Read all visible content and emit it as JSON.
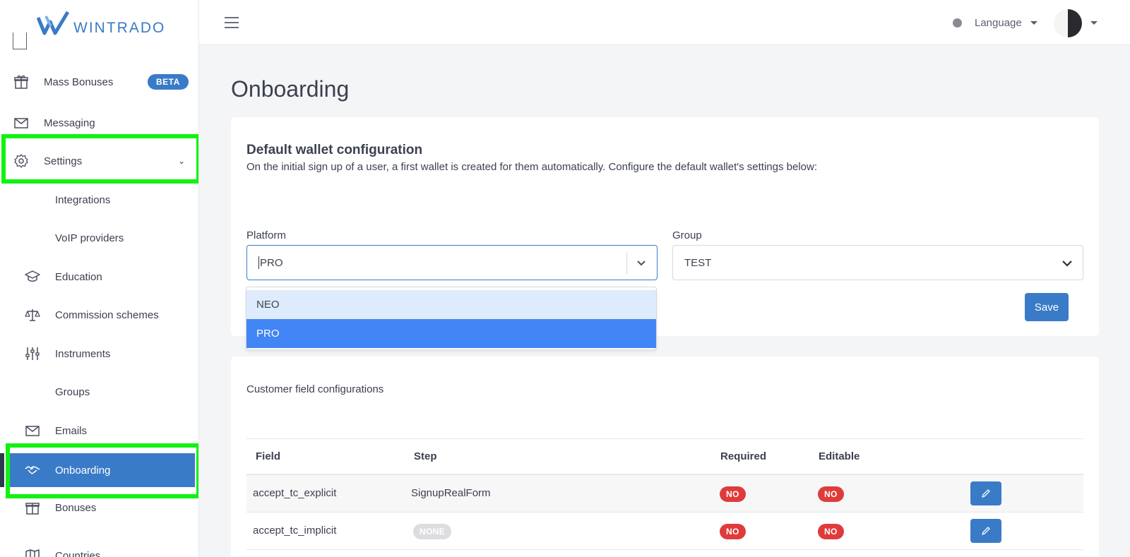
{
  "brand": {
    "name": "WINTRADO",
    "accent": "#3a7bc8"
  },
  "sidebar": {
    "items": [
      {
        "label": "Mass Bonuses",
        "icon": "gift-icon",
        "badge": "BETA"
      },
      {
        "label": "Messaging",
        "icon": "envelope-icon"
      },
      {
        "label": "Settings",
        "icon": "gear-icon",
        "expanded": true
      },
      {
        "label": "Integrations"
      },
      {
        "label": "VoIP providers"
      },
      {
        "label": "Education",
        "icon": "graduation-cap-icon"
      },
      {
        "label": "Commission schemes",
        "icon": "scales-icon"
      },
      {
        "label": "Instruments",
        "icon": "sliders-icon"
      },
      {
        "label": "Groups"
      },
      {
        "label": "Emails",
        "icon": "envelope-icon"
      },
      {
        "label": "Onboarding",
        "icon": "handshake-icon",
        "active": true
      },
      {
        "label": "Bonuses",
        "icon": "gift-icon"
      },
      {
        "label": "Countries",
        "icon": "map-icon"
      }
    ]
  },
  "topbar": {
    "language_label": "Language"
  },
  "page": {
    "title": "Onboarding"
  },
  "wallet_config": {
    "title": "Default wallet configuration",
    "description": "On the initial sign up of a user, a first wallet is created for them automatically. Configure the default wallet's settings below:",
    "platform_label": "Platform",
    "platform_value": "PRO",
    "platform_options": [
      "NEO",
      "PRO"
    ],
    "group_label": "Group",
    "group_value": "TEST",
    "save_label": "Save"
  },
  "customer_fields": {
    "title": "Customer field configurations",
    "columns": [
      "Field",
      "Step",
      "Required",
      "Editable"
    ],
    "rows": [
      {
        "field": "accept_tc_explicit",
        "step": "SignupRealForm",
        "step_is_badge": false,
        "required": "NO",
        "editable": "NO"
      },
      {
        "field": "accept_tc_implicit",
        "step": "NONE",
        "step_is_badge": true,
        "required": "NO",
        "editable": "NO"
      }
    ]
  }
}
